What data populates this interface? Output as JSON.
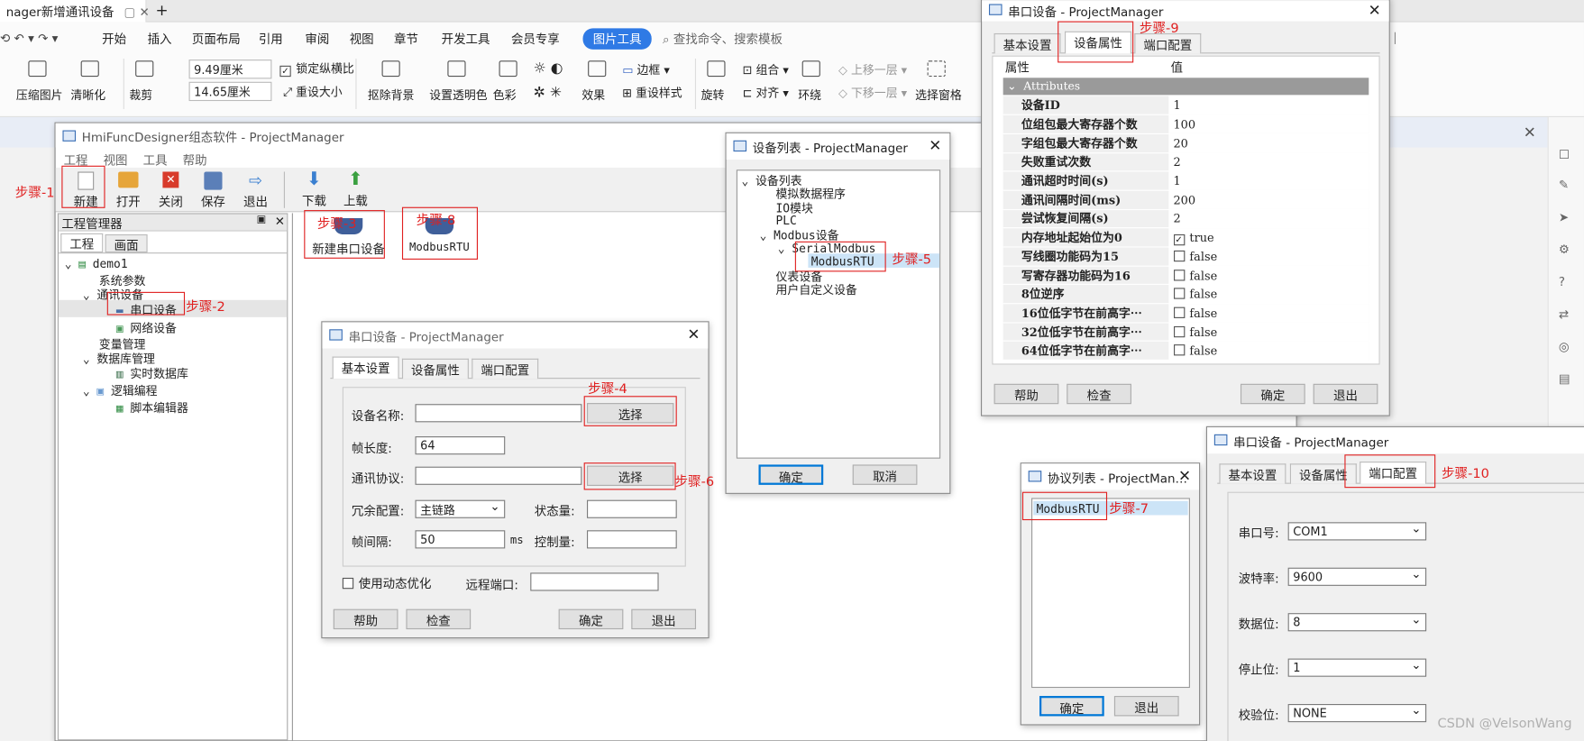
{
  "wps": {
    "doc_tab": "nager新增通讯设备",
    "new_tab": "+",
    "menu": [
      "开始",
      "插入",
      "页面布局",
      "引用",
      "审阅",
      "视图",
      "章节",
      "开发工具",
      "会员专享",
      "图片工具"
    ],
    "search": "查找命令、搜索模板",
    "ribbon": {
      "compress": "压缩图片",
      "clarify": "清晰化",
      "crop": "裁剪",
      "width": "9.49厘米",
      "height": "14.65厘米",
      "lock_ratio": "锁定纵横比",
      "reset_size": "重设大小",
      "cutout": "抠除背景",
      "transparent": "设置透明色",
      "color": "色彩",
      "effect": "效果",
      "border": "边框",
      "reset_style": "重设样式",
      "rotate": "旋转",
      "group": "组合",
      "align": "对齐",
      "wrap": "环绕",
      "up": "上移一层",
      "down": "下移一层",
      "select_pane": "选择窗格"
    }
  },
  "main": {
    "title": "HmiFuncDesigner组态软件 - ProjectManager",
    "menu": [
      "工程",
      "视图",
      "工具",
      "帮助"
    ],
    "toolbar": [
      "新建",
      "打开",
      "关闭",
      "保存",
      "退出",
      "下载",
      "上载"
    ],
    "pm_title": "工程管理器",
    "pm_tabs": [
      "工程",
      "画面"
    ],
    "tree": [
      "demo1",
      "系统参数",
      "通讯设备",
      "串口设备",
      "网络设备",
      "变量管理",
      "数据库管理",
      "实时数据库",
      "逻辑编程",
      "脚本编辑器"
    ],
    "devices": [
      "新建串口设备",
      "ModbusRTU"
    ]
  },
  "serial1": {
    "title": "串口设备 - ProjectManager",
    "tabs": [
      "基本设置",
      "设备属性",
      "端口配置"
    ],
    "name_lbl": "设备名称:",
    "select": "选择",
    "frame_len_lbl": "帧长度:",
    "frame_len": "64",
    "protocol_lbl": "通讯协议:",
    "redundant_lbl": "冗余配置:",
    "redundant": "主链路",
    "state_lbl": "状态量:",
    "interval_lbl": "帧间隔:",
    "interval": "50",
    "ms": "ms",
    "control_lbl": "控制量:",
    "dynamic": "使用动态优化",
    "remote_lbl": "远程端口:",
    "help": "帮助",
    "check": "检查",
    "ok": "确定",
    "exit": "退出"
  },
  "devlist": {
    "title": "设备列表 - ProjectManager",
    "items": [
      "设备列表",
      "模拟数据程序",
      "IO模块",
      "PLC",
      "Modbus设备",
      "SerialModbus",
      "ModbusRTU",
      "仪表设备",
      "用户自定义设备"
    ],
    "ok": "确定",
    "cancel": "取消"
  },
  "protolist": {
    "title": "协议列表 - ProjectMan…",
    "item": "ModbusRTU",
    "ok": "确定",
    "exit": "退出"
  },
  "props": {
    "title": "串口设备 - ProjectManager",
    "tabs": [
      "基本设置",
      "设备属性",
      "端口配置"
    ],
    "col1": "属性",
    "col2": "值",
    "group": "Attributes",
    "rows": [
      [
        "设备ID",
        "1"
      ],
      [
        "位组包最大寄存器个数",
        "100"
      ],
      [
        "字组包最大寄存器个数",
        "20"
      ],
      [
        "失败重试次数",
        "2"
      ],
      [
        "通讯超时时间(s)",
        "1"
      ],
      [
        "通讯间隔时间(ms)",
        "200"
      ],
      [
        "尝试恢复间隔(s)",
        "2"
      ],
      [
        "内存地址起始位为0",
        "true"
      ],
      [
        "写线圈功能码为15",
        "false"
      ],
      [
        "写寄存器功能码为16",
        "false"
      ],
      [
        "8位逆序",
        "false"
      ],
      [
        "16位低字节在前高字⋯",
        "false"
      ],
      [
        "32位低字节在前高字⋯",
        "false"
      ],
      [
        "64位低字节在前高字⋯",
        "false"
      ]
    ],
    "help": "帮助",
    "check": "检查",
    "ok": "确定",
    "exit": "退出"
  },
  "port": {
    "title": "串口设备 - ProjectManager",
    "tabs": [
      "基本设置",
      "设备属性",
      "端口配置"
    ],
    "rows": [
      [
        "串口号:",
        "COM1"
      ],
      [
        "波特率:",
        "9600"
      ],
      [
        "数据位:",
        "8"
      ],
      [
        "停止位:",
        "1"
      ],
      [
        "校验位:",
        "NONE"
      ]
    ]
  },
  "steps": [
    "步骤-1",
    "步骤-2",
    "步骤-3",
    "步骤-4",
    "步骤-5",
    "步骤-6",
    "步骤-7",
    "步骤-8",
    "步骤-9",
    "步骤-10"
  ],
  "watermark": "CSDN @VelsonWang"
}
